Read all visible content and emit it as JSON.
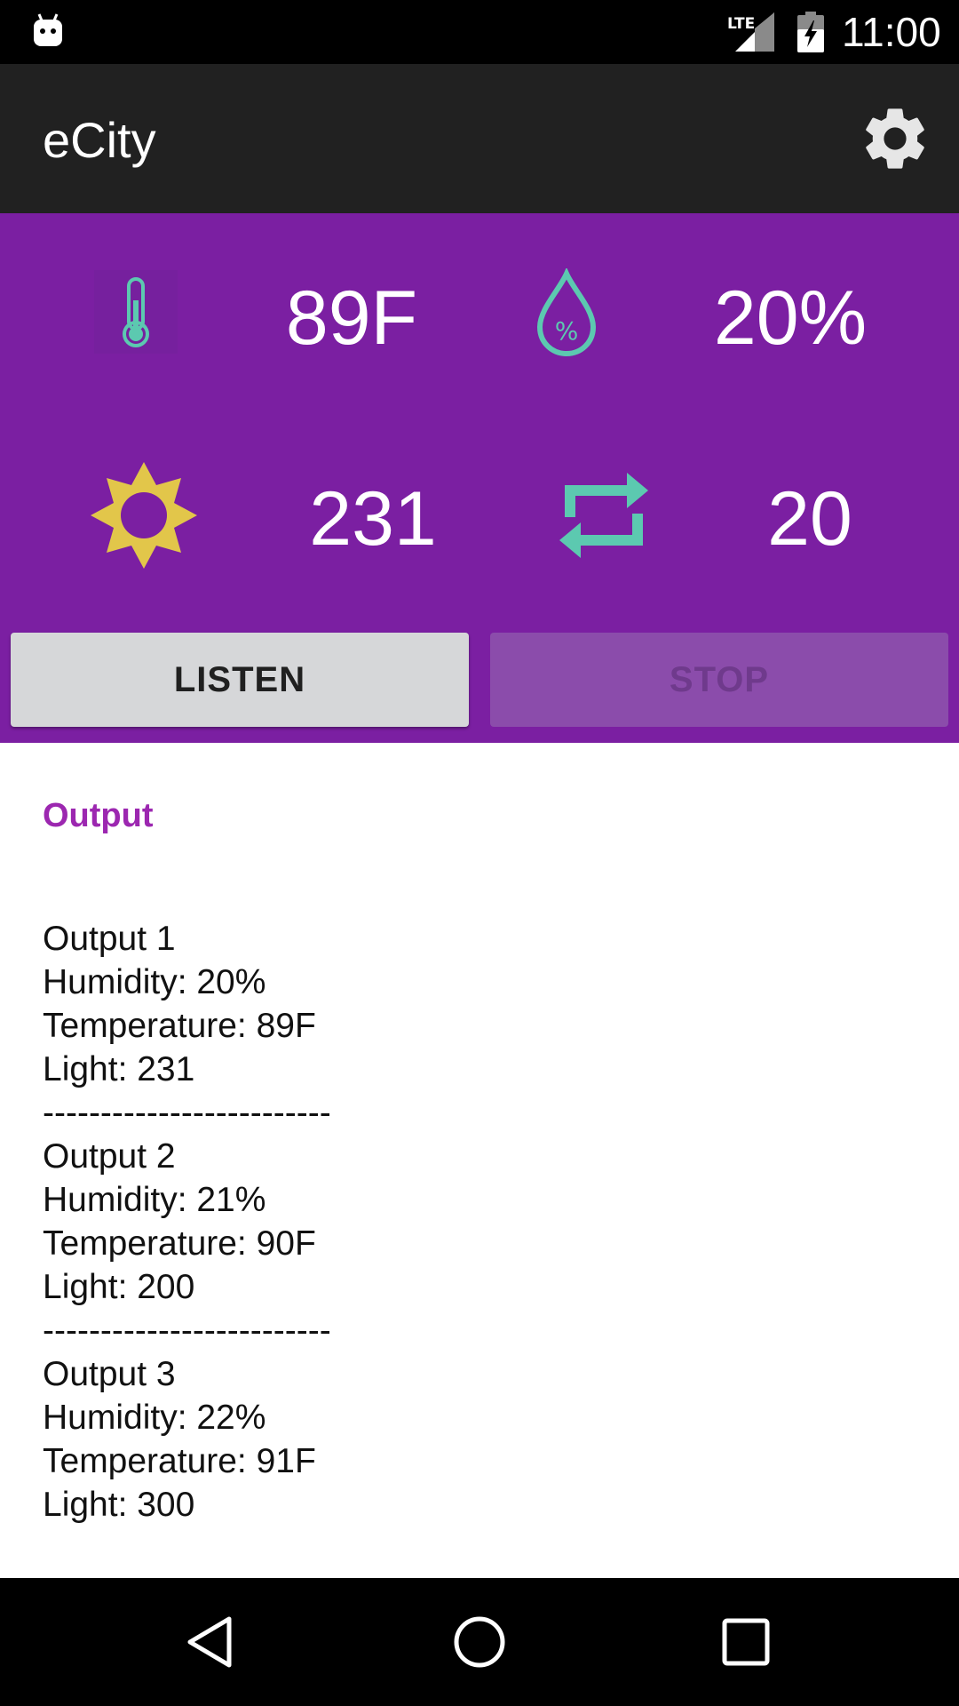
{
  "status_bar": {
    "time": "11:00",
    "network": "LTE",
    "icons": [
      "android-robot-icon",
      "lte-signal-icon",
      "battery-charging-icon"
    ]
  },
  "app_bar": {
    "title": "eCity",
    "settings_icon": "gear-icon"
  },
  "sensors": {
    "temperature": {
      "icon": "thermometer-icon",
      "value": "89F"
    },
    "humidity": {
      "icon": "humidity-drop-icon",
      "value": "20%"
    },
    "light": {
      "icon": "sun-icon",
      "value": "231"
    },
    "count": {
      "icon": "repeat-icon",
      "value": "20"
    }
  },
  "buttons": {
    "listen_label": "LISTEN",
    "stop_label": "STOP",
    "stop_enabled": false
  },
  "output": {
    "title": "Output",
    "lines": [
      "Output 1",
      "Humidity: 20%",
      "Temperature: 89F",
      "Light: 231",
      "-------------------------",
      "Output 2",
      "Humidity: 21%",
      "Temperature: 90F",
      "Light: 200",
      "-------------------------",
      "Output 3",
      "Humidity: 22%",
      "Temperature: 91F",
      "Light: 300"
    ]
  },
  "nav_bar": {
    "icons": [
      "back-icon",
      "home-icon",
      "recents-icon"
    ]
  },
  "colors": {
    "primary_dark": "#7b1fa2",
    "app_bar": "#212121",
    "accent": "#9c27b0",
    "teal_icon": "#5cc9b0",
    "sun_icon": "#e2c64a"
  }
}
